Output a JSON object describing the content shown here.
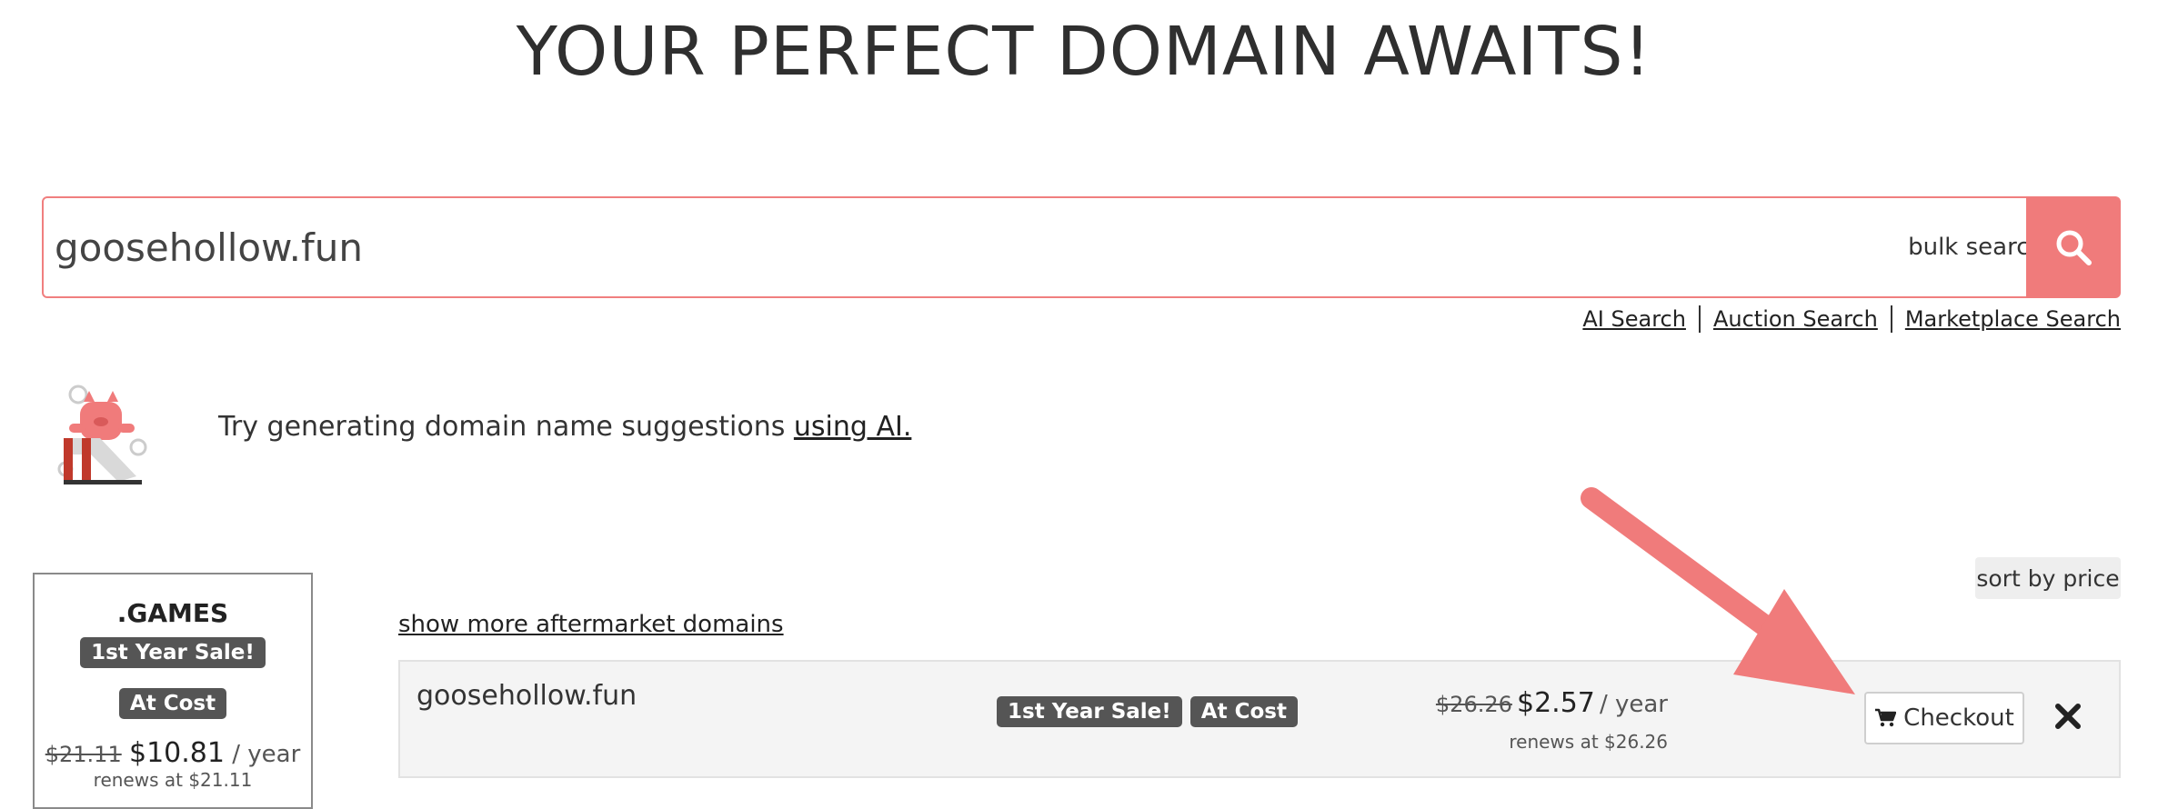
{
  "hero": {
    "title": "YOUR PERFECT DOMAIN AWAITS!"
  },
  "search": {
    "value": "goosehollow.fun",
    "bulk_label": "bulk search",
    "icon": "search-icon"
  },
  "search_links": [
    {
      "label": "AI Search"
    },
    {
      "label": "Auction Search"
    },
    {
      "label": "Marketplace Search"
    }
  ],
  "ai_prompt": {
    "text": "Try generating domain name suggestions ",
    "link": "using AI."
  },
  "tld_card": {
    "name": ".GAMES",
    "badge_sale": "1st Year Sale!",
    "badge_cost": "At Cost",
    "old_price": "$21.11",
    "price": "$10.81",
    "per": "/ year",
    "renew": "renews at $21.11"
  },
  "results": {
    "show_more": "show more aftermarket domains",
    "sort_label": "sort by price",
    "row": {
      "domain": "goosehollow.fun",
      "badge_sale": "1st Year Sale!",
      "badge_cost": "At Cost",
      "old_price": "$26.26",
      "price": "$2.57",
      "per": "/ year",
      "renew": "renews at $26.26",
      "checkout_label": "Checkout"
    }
  },
  "colors": {
    "accent": "#f07b7b",
    "badge": "#555555",
    "row_bg": "#f4f4f4"
  }
}
